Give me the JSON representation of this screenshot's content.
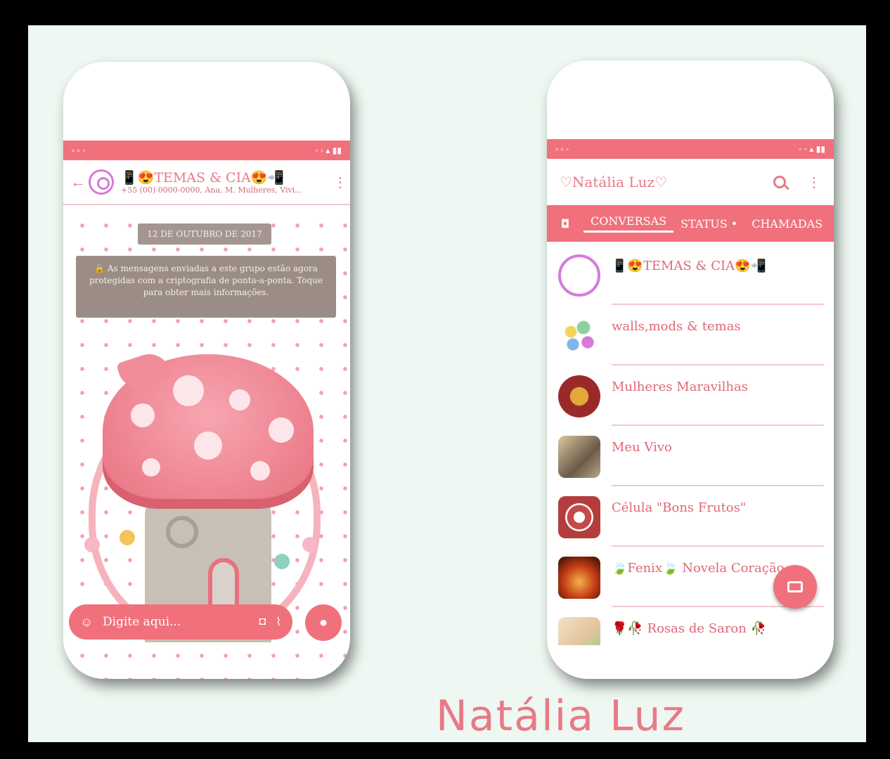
{
  "left_phone": {
    "chat_title": "📱😍TEMAS & CIA😍📲",
    "chat_subtitle": "+55 (00) 0000-0000, Ana, M. Mulheres, Vivi...",
    "date_label": "12 DE OUTUBRO DE 2017",
    "notice_text": "🔒 As mensagens enviadas a este grupo estão agora protegidas com a criptografia de ponta-a-ponta. Toque para obter mais informações.",
    "composer_placeholder": "Digite aqui...",
    "icons": [
      "back-arrow",
      "whatsapp-logo",
      "kebab-menu",
      "emoji",
      "camera",
      "attach-clip",
      "microphone"
    ]
  },
  "right_phone": {
    "app_title": "♡Natália Luz♡",
    "tabs": [
      {
        "label": "CONVERSAS",
        "active": true
      },
      {
        "label": "STATUS •",
        "active": false
      },
      {
        "label": "CHAMADAS",
        "active": false
      }
    ],
    "chats": [
      {
        "name": "📱😍TEMAS & CIA😍📲",
        "avatar": "whatsapp-logo"
      },
      {
        "name": "walls,mods & temas",
        "avatar": "flowers"
      },
      {
        "name": "Mulheres Maravilhas",
        "avatar": "wonder-woman-logo"
      },
      {
        "name": "Meu Vivo",
        "avatar": "photo"
      },
      {
        "name": "Célula \"Bons Frutos\"",
        "avatar": "cell-logo"
      },
      {
        "name": "🍃Fenix🍃 Novela Coração...",
        "avatar": "fire-photo"
      },
      {
        "name": "🌹🥀 Rosas de Saron 🥀",
        "avatar": "roses-photo"
      }
    ],
    "icons": [
      "search",
      "kebab-menu",
      "camera-tab",
      "new-chat"
    ]
  },
  "signature": "Natália Luz",
  "colors": {
    "accent": "#f0707c",
    "text_pink": "#e87a86",
    "background": "#eef7f1"
  }
}
